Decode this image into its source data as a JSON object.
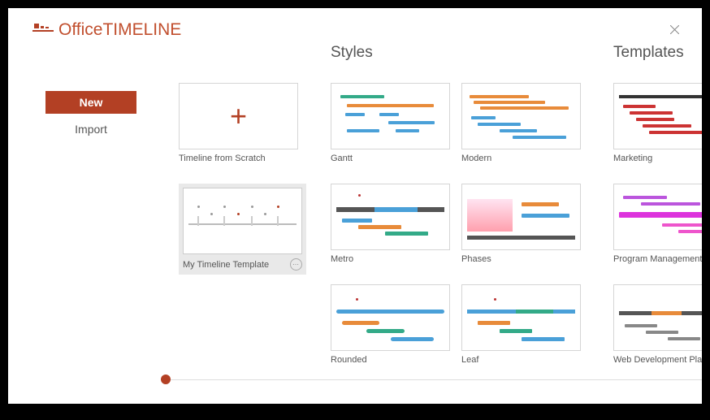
{
  "brand": {
    "name_left": "Office",
    "name_right": "TIMELINE"
  },
  "sidebar": {
    "items": [
      {
        "label": "New",
        "primary": true
      },
      {
        "label": "Import",
        "primary": false
      }
    ]
  },
  "user_items_title": "",
  "user_items": [
    {
      "id": "scratch",
      "label": "Timeline from Scratch",
      "kind": "plus"
    },
    {
      "id": "custom",
      "label": "My Timeline Template",
      "kind": "custom",
      "more": true
    }
  ],
  "styles_title": "Styles",
  "styles": [
    {
      "id": "gantt",
      "label": "Gantt"
    },
    {
      "id": "modern",
      "label": "Modern"
    },
    {
      "id": "metro",
      "label": "Metro"
    },
    {
      "id": "phases",
      "label": "Phases"
    },
    {
      "id": "rounded",
      "label": "Rounded"
    },
    {
      "id": "leaf",
      "label": "Leaf"
    }
  ],
  "templates_title": "Templates",
  "templates": [
    {
      "id": "marketing",
      "label": "Marketing"
    },
    {
      "id": "program",
      "label": "Program Management"
    },
    {
      "id": "webdev",
      "label": "Web Development Plan"
    }
  ]
}
